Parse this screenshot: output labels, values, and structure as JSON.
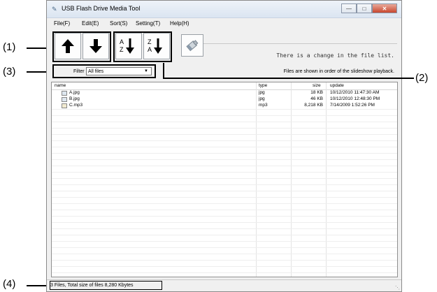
{
  "window": {
    "title": "USB Flash Drive Media Tool",
    "controls": [
      "minimize-icon",
      "maximize-icon",
      "close-icon"
    ]
  },
  "menu": [
    "File(F)",
    "Edit(E)",
    "Sort(S)",
    "Setting(T)",
    "Help(H)"
  ],
  "toolbar": {
    "buttons": [
      "move-up-icon",
      "move-down-icon",
      "sort-ascending-icon",
      "sort-descending-icon",
      "usb-drive-icon"
    ],
    "sort_asc_labels": [
      "A",
      "Z"
    ],
    "sort_desc_labels": [
      "Z",
      "A"
    ]
  },
  "notice": "There is a change in the file list.",
  "filter": {
    "label": "Filter",
    "selected": "All files",
    "info": "Files are shown in order of the slideshow playback."
  },
  "list": {
    "columns": [
      "name",
      "type",
      "size",
      "update"
    ],
    "rows": [
      {
        "name": "A.jpg",
        "type": "jpg",
        "size": "18 KB",
        "update": "10/12/2010 11:47:30 AM"
      },
      {
        "name": "B.jpg",
        "type": "jpg",
        "size": "46 KB",
        "update": "10/12/2010 12:48:30 PM"
      },
      {
        "name": "C.mp3",
        "type": "mp3",
        "size": "8,218 KB",
        "update": "7/14/2009 1:52:26 PM"
      }
    ]
  },
  "status": "3 Files,  Total size of files 8,280 Kbytes",
  "callouts": [
    "(1)",
    "(2)",
    "(3)",
    "(4)"
  ]
}
